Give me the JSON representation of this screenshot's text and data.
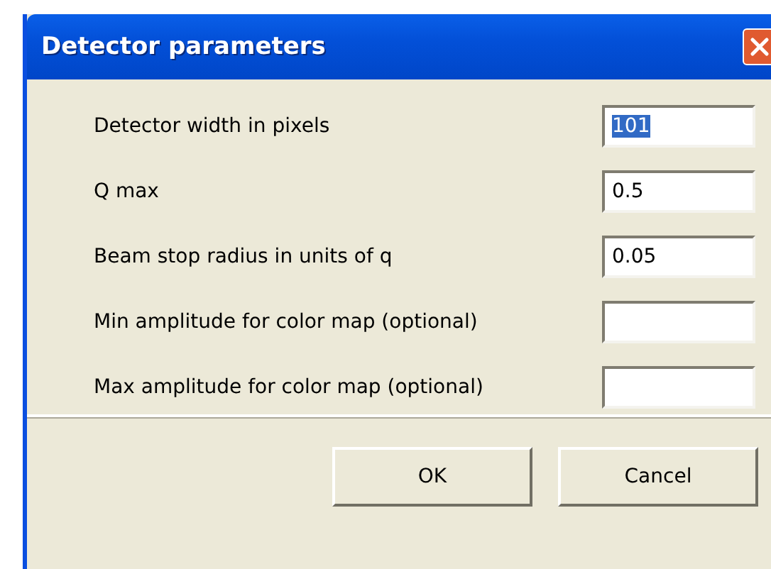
{
  "window": {
    "title": "Detector parameters"
  },
  "fields": [
    {
      "label": "Detector width in pixels",
      "value": "101",
      "text_selected": true
    },
    {
      "label": "Q max",
      "value": "0.5",
      "text_selected": false
    },
    {
      "label": "Beam stop radius in units of q",
      "value": "0.05",
      "text_selected": false
    },
    {
      "label": "Min amplitude for color map (optional)"
    },
    {
      "label": "Max amplitude for color map (optional)"
    }
  ],
  "buttons": [
    "OK",
    "Cancel"
  ]
}
